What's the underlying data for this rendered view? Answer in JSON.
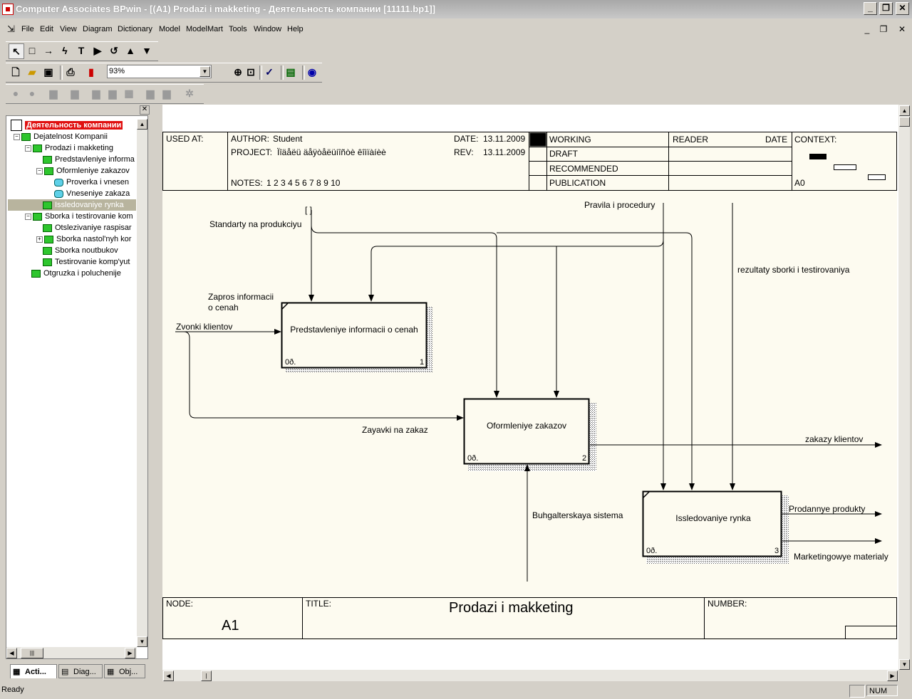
{
  "window": {
    "title": "Computer Associates BPwin - [(A1) Prodazi i makketing - Деятельность компании  [11111.bp1]]",
    "min": "_",
    "max": "❐",
    "close": "✕"
  },
  "menu": [
    "File",
    "Edit",
    "View",
    "Diagram",
    "Dictionary",
    "Model",
    "ModelMart",
    "Tools",
    "Window",
    "Help"
  ],
  "toolbar": {
    "zoom": "93%"
  },
  "tree": {
    "root": "Деятельность компании",
    "items": [
      {
        "label": "Dejatelnost Kompanii",
        "type": "sq"
      },
      {
        "label": "Prodazi i makketing",
        "type": "sq"
      },
      {
        "label": "Predstavleniye informa",
        "type": "sq"
      },
      {
        "label": "Oformleniye zakazov",
        "type": "sq"
      },
      {
        "label": "Proverka i vnesen",
        "type": "cyl"
      },
      {
        "label": "Vneseniye zakaza",
        "type": "cyl"
      },
      {
        "label": "Issledovaniye rynka",
        "type": "sq"
      },
      {
        "label": "Sborka i testirovanie kom",
        "type": "sq"
      },
      {
        "label": "Otslezivaniye raspisar",
        "type": "sq"
      },
      {
        "label": "Sborka nastol'nyh kor",
        "type": "sq"
      },
      {
        "label": "Sborka noutbukov",
        "type": "sq"
      },
      {
        "label": "Testirovanie komp'yut",
        "type": "sq"
      },
      {
        "label": "Otgruzka i poluchenije",
        "type": "sq"
      }
    ]
  },
  "tabs": [
    "Acti...",
    "Diag...",
    "Obj..."
  ],
  "frame": {
    "used_at": "USED AT:",
    "author_label": "AUTHOR:",
    "author": "Student",
    "project_label": "PROJECT:",
    "project": "Ïîäåëü äåÿòåëüíîñòè êîìïàíèè",
    "date_label": "DATE:",
    "date": "13.11.2009",
    "rev_label": "REV:",
    "rev": "13.11.2009",
    "notes_label": "NOTES:",
    "notes": "1  2  3  4  5  6  7  8  9  10",
    "working": "WORKING",
    "draft": "DRAFT",
    "recommended": "RECOMMENDED",
    "publication": "PUBLICATION",
    "reader": "READER",
    "reader_date": "DATE",
    "context": "CONTEXT:",
    "context_node": "A0",
    "node_label": "NODE:",
    "node": "A1",
    "title_label": "TITLE:",
    "title": "Prodazi i makketing",
    "number_label": "NUMBER:"
  },
  "boxes": [
    {
      "name": "Predstavleniye informacii o cenah",
      "cost": "0ð.",
      "num": "1"
    },
    {
      "name": "Oformleniye zakazov",
      "cost": "0ð.",
      "num": "2"
    },
    {
      "name": "Issledovaniye rynka",
      "cost": "0ð.",
      "num": "3"
    }
  ],
  "arrows": {
    "standarty": "Standarty na produkciyu",
    "pravila": "Pravila i procedury",
    "rezultaty": "rezultaty sborki i testirovaniya",
    "zapros1": "Zapros informacii",
    "zapros2": "o cenah",
    "zvonki": "Zvonki klientov",
    "zayavki": "Zayavki na zakaz",
    "zakazy": "zakazy klientov",
    "buhgalter": "Buhgalterskaya sistema",
    "prodannye": "Prodannye produkty",
    "marketing": "Marketingowye materialy",
    "tunnel": "[ ]"
  },
  "status": {
    "left": "Ready",
    "num": "NUM"
  }
}
